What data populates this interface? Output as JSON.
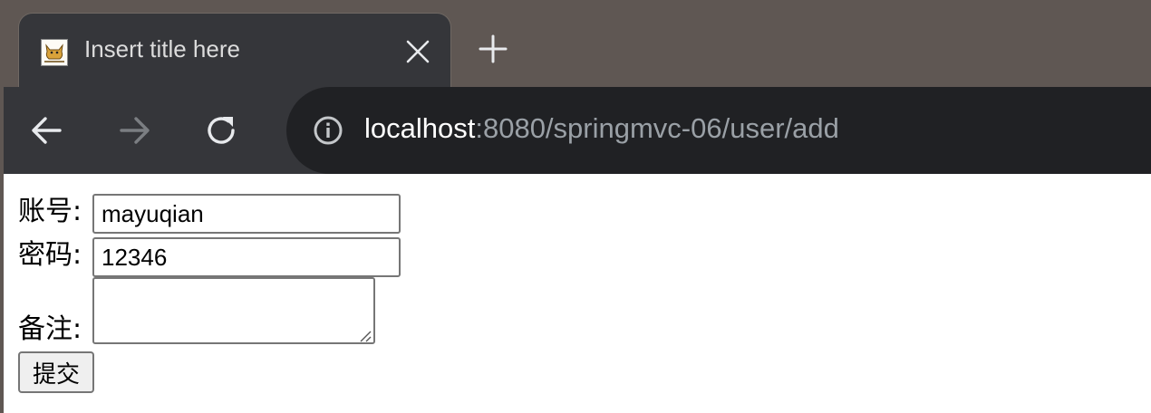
{
  "tab": {
    "title": "Insert title here",
    "favicon": "tomcat-icon"
  },
  "address": {
    "host": "localhost",
    "path": ":8080/springmvc-06/user/add"
  },
  "form": {
    "account_label": "账号:",
    "account_value": "mayuqian",
    "password_label": "密码:",
    "password_value": "12346",
    "remark_label": "备注:",
    "remark_value": "",
    "submit_label": "提交"
  }
}
